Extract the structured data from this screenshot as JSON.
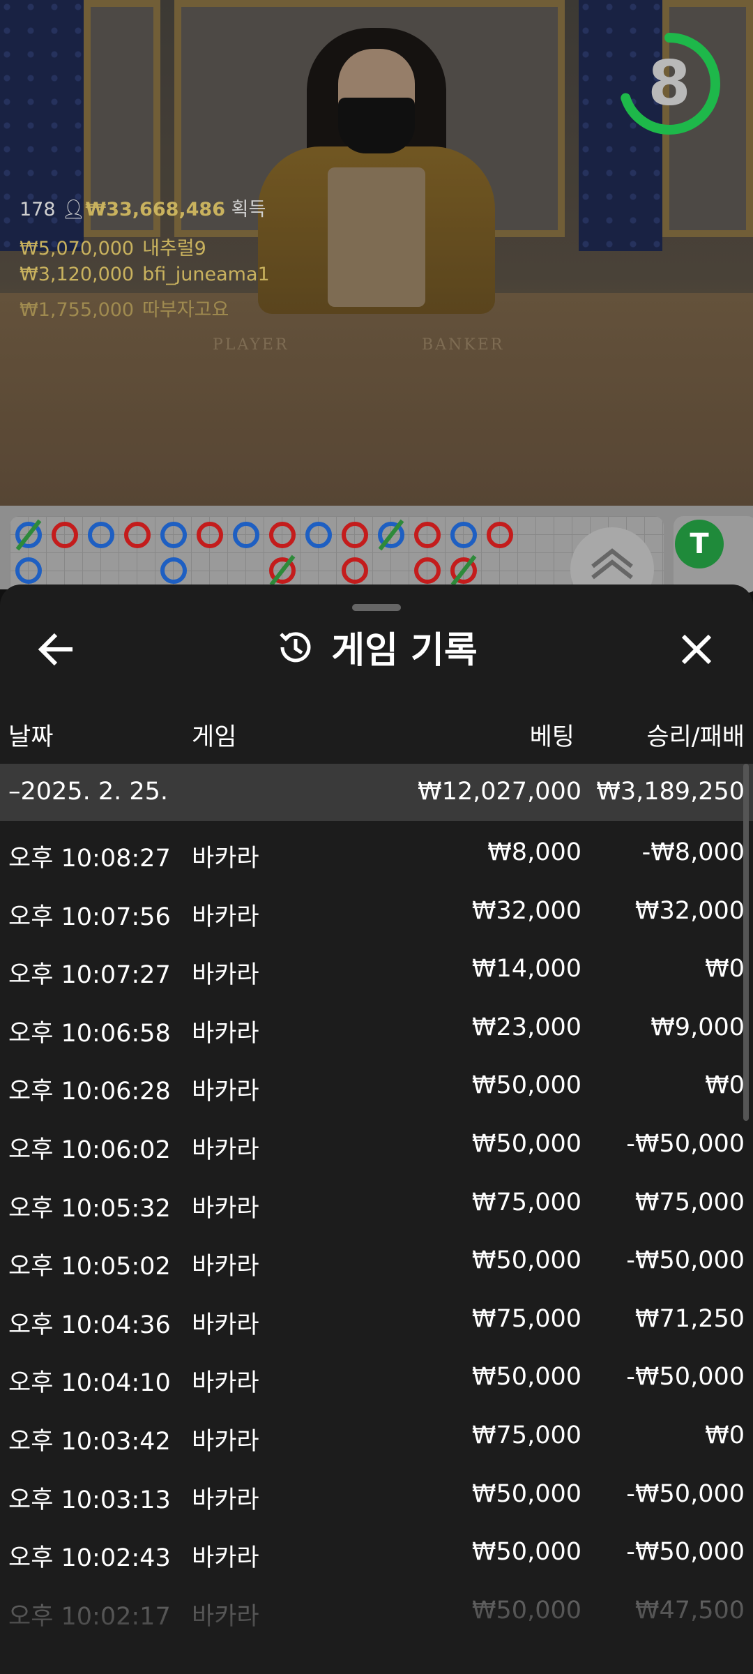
{
  "stream": {
    "timer": "8",
    "top_count": "178",
    "top_amount": "₩33,668,486",
    "top_label": "획득",
    "winners": [
      {
        "amount": "₩5,070,000",
        "name": "내추럴9"
      },
      {
        "amount": "₩3,120,000",
        "name": "bfi_juneama1"
      },
      {
        "amount": "₩1,755,000",
        "name": "따부자고요"
      }
    ],
    "table_labels": {
      "player": "PLAYER",
      "banker": "BANKER"
    },
    "tie_badge": "T",
    "colors": {
      "player": "#1e5fc2",
      "banker": "#c41c1c",
      "tie": "#2e8a3a",
      "timer_ring": "#1eb84a"
    }
  },
  "sheet": {
    "title": "게임 기록",
    "icons": {
      "back": "arrow-left-icon",
      "history": "history-icon",
      "close": "close-icon"
    },
    "columns": {
      "date": "날짜",
      "game": "게임",
      "bet": "베팅",
      "result": "승리/패배"
    },
    "date_group": {
      "label": "–2025. 2. 25.",
      "bet": "₩12,027,000",
      "result": "₩3,189,250"
    },
    "rows": [
      {
        "time": "오후 10:08:27",
        "game": "바카라",
        "bet": "₩8,000",
        "result": "-₩8,000"
      },
      {
        "time": "오후 10:07:56",
        "game": "바카라",
        "bet": "₩32,000",
        "result": "₩32,000"
      },
      {
        "time": "오후 10:07:27",
        "game": "바카라",
        "bet": "₩14,000",
        "result": "₩0"
      },
      {
        "time": "오후 10:06:58",
        "game": "바카라",
        "bet": "₩23,000",
        "result": "₩9,000"
      },
      {
        "time": "오후 10:06:28",
        "game": "바카라",
        "bet": "₩50,000",
        "result": "₩0"
      },
      {
        "time": "오후 10:06:02",
        "game": "바카라",
        "bet": "₩50,000",
        "result": "-₩50,000"
      },
      {
        "time": "오후 10:05:32",
        "game": "바카라",
        "bet": "₩75,000",
        "result": "₩75,000"
      },
      {
        "time": "오후 10:05:02",
        "game": "바카라",
        "bet": "₩50,000",
        "result": "-₩50,000"
      },
      {
        "time": "오후 10:04:36",
        "game": "바카라",
        "bet": "₩75,000",
        "result": "₩71,250"
      },
      {
        "time": "오후 10:04:10",
        "game": "바카라",
        "bet": "₩50,000",
        "result": "-₩50,000"
      },
      {
        "time": "오후 10:03:42",
        "game": "바카라",
        "bet": "₩75,000",
        "result": "₩0"
      },
      {
        "time": "오후 10:03:13",
        "game": "바카라",
        "bet": "₩50,000",
        "result": "-₩50,000"
      },
      {
        "time": "오후 10:02:43",
        "game": "바카라",
        "bet": "₩50,000",
        "result": "-₩50,000"
      },
      {
        "time": "오후 10:02:17",
        "game": "바카라",
        "bet": "₩50,000",
        "result": "₩47,500"
      }
    ]
  }
}
